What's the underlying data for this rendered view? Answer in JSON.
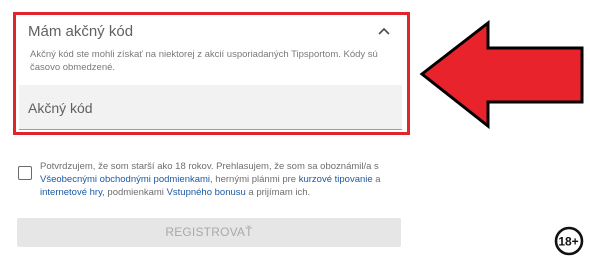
{
  "promo": {
    "title": "Mám akčný kód",
    "description": "Akčný kód ste mohli získať na niektorej z akcií usporiadaných Tipsportom. Kódy sú časovo obmedzené.",
    "code_placeholder": "Akčný kód",
    "code_value": "",
    "expanded": true,
    "border_color": "#e0262b"
  },
  "annotation": {
    "arrow_color": "#e8232b",
    "arrow_icon": "left-arrow-icon"
  },
  "consent": {
    "checked": false,
    "text_1": "Potvrdzujem, že som starší ako 18 rokov. Prehlasujem, že som sa oboznámil/a s ",
    "link_terms": "Všeobecnými obchodnými podmienkami",
    "text_2": ", hernými plánmi pre ",
    "link_course": "kurzové tipovanie",
    "text_3": " a ",
    "link_internet": "internetové hry",
    "text_4": ", podmienkami ",
    "link_bonus": "Vstupného bonusu",
    "text_5": " a prijímam ich.",
    "link_color": "#1b5aa8"
  },
  "register": {
    "label": "REGISTROVAŤ",
    "enabled": false
  },
  "age_badge": {
    "label": "18+",
    "icon": "age-restriction-icon"
  }
}
